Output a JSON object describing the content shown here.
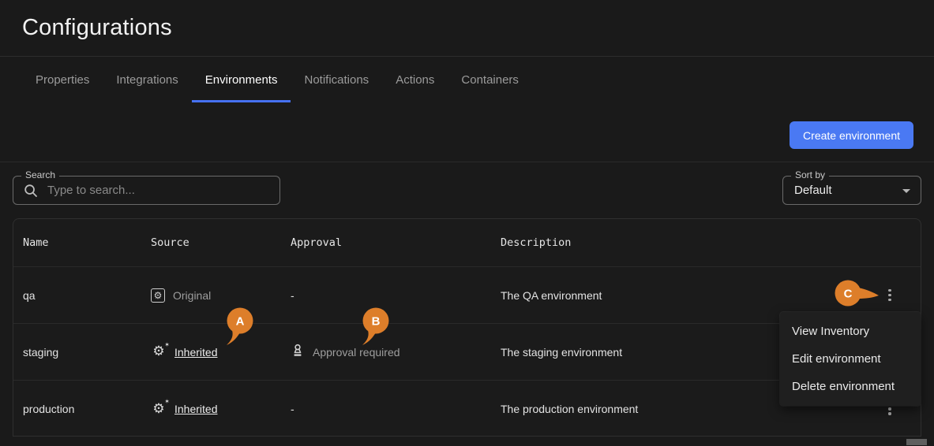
{
  "page": {
    "title": "Configurations"
  },
  "tabs": [
    {
      "label": "Properties",
      "active": false
    },
    {
      "label": "Integrations",
      "active": false
    },
    {
      "label": "Environments",
      "active": true
    },
    {
      "label": "Notifications",
      "active": false
    },
    {
      "label": "Actions",
      "active": false
    },
    {
      "label": "Containers",
      "active": false
    }
  ],
  "toolbar": {
    "create_label": "Create environment"
  },
  "filters": {
    "search_label": "Search",
    "search_placeholder": "Type to search...",
    "sort_label": "Sort by",
    "sort_value": "Default"
  },
  "table": {
    "columns": {
      "name": "Name",
      "source": "Source",
      "approval": "Approval",
      "description": "Description"
    },
    "rows": [
      {
        "name": "qa",
        "source": "Original",
        "approval": "-",
        "description": "The QA environment"
      },
      {
        "name": "staging",
        "source": "Inherited",
        "approval": "Approval required",
        "description": "The staging environment"
      },
      {
        "name": "production",
        "source": "Inherited",
        "approval": "-",
        "description": "The production environment"
      }
    ]
  },
  "context_menu": {
    "items": [
      "View Inventory",
      "Edit environment",
      "Delete environment"
    ]
  },
  "annotations": [
    {
      "label": "A"
    },
    {
      "label": "B"
    },
    {
      "label": "C"
    }
  ],
  "icons": {
    "search": "magnifier-icon",
    "original_source": "gear-in-box-icon",
    "inherited_source": "gear-sparkle-icon",
    "approval": "stamp-icon",
    "row_menu": "kebab-icon",
    "sort": "chevron-down-icon"
  },
  "colors": {
    "accent_blue": "#4a79f3",
    "tab_indicator_blue": "#4671f2",
    "annotation_orange": "#dd7e2a",
    "background": "#1a1a1a",
    "muted_text": "#9e9e9e"
  }
}
